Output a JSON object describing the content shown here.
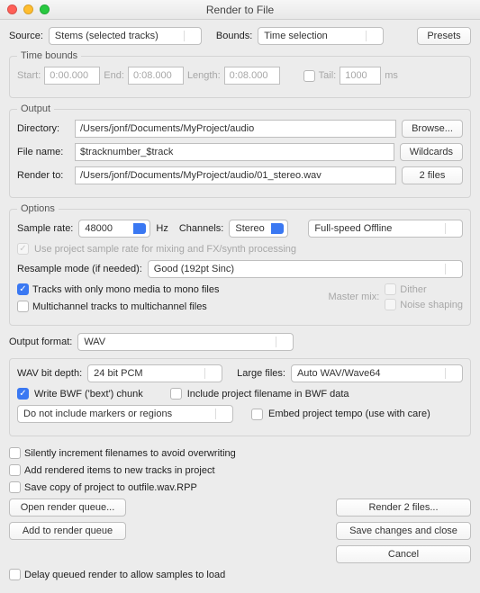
{
  "titlebar": {
    "title": "Render to File"
  },
  "top": {
    "source_label": "Source:",
    "source_value": "Stems (selected tracks)",
    "bounds_label": "Bounds:",
    "bounds_value": "Time selection",
    "presets": "Presets"
  },
  "timebounds": {
    "legend": "Time bounds",
    "start_label": "Start:",
    "start_value": "0:00.000",
    "end_label": "End:",
    "end_value": "0:08.000",
    "length_label": "Length:",
    "length_value": "0:08.000",
    "tail_label": "Tail:",
    "tail_value": "1000",
    "ms": "ms"
  },
  "output": {
    "legend": "Output",
    "directory_label": "Directory:",
    "directory_value": "/Users/jonf/Documents/MyProject/audio",
    "browse": "Browse...",
    "filename_label": "File name:",
    "filename_value": "$tracknumber_$track",
    "wildcards": "Wildcards",
    "render_to_label": "Render to:",
    "render_to_value": "/Users/jonf/Documents/MyProject/audio/01_stereo.wav",
    "two_files": "2 files"
  },
  "options": {
    "legend": "Options",
    "sample_rate_label": "Sample rate:",
    "sample_rate_value": "48000",
    "hz": "Hz",
    "channels_label": "Channels:",
    "channels_value": "Stereo",
    "offline_value": "Full-speed Offline",
    "use_project_sr": "Use project sample rate for mixing and FX/synth processing",
    "resample_label": "Resample mode (if needed):",
    "resample_value": "Good (192pt Sinc)",
    "mono_tracks": "Tracks with only mono media to mono files",
    "multichannel": "Multichannel tracks to multichannel files",
    "master_mix": "Master mix:",
    "dither": "Dither",
    "noise_shaping": "Noise shaping"
  },
  "format_row": {
    "label": "Output format:",
    "value": "WAV"
  },
  "wav": {
    "bit_depth_label": "WAV bit depth:",
    "bit_depth_value": "24 bit PCM",
    "large_files_label": "Large files:",
    "large_files_value": "Auto WAV/Wave64",
    "write_bwf": "Write BWF ('bext') chunk",
    "include_proj": "Include project filename in BWF data",
    "markers_value": "Do not include markers or regions",
    "embed_tempo": "Embed project tempo (use with care)"
  },
  "bottom": {
    "silent_inc": "Silently increment filenames to avoid overwriting",
    "add_rendered": "Add rendered items to new tracks in project",
    "save_copy": "Save copy of project to outfile.wav.RPP",
    "open_queue": "Open render queue...",
    "add_queue": "Add to render queue",
    "render": "Render 2 files...",
    "save_close": "Save changes and close",
    "cancel": "Cancel",
    "delay_queued": "Delay queued render to allow samples to load"
  }
}
